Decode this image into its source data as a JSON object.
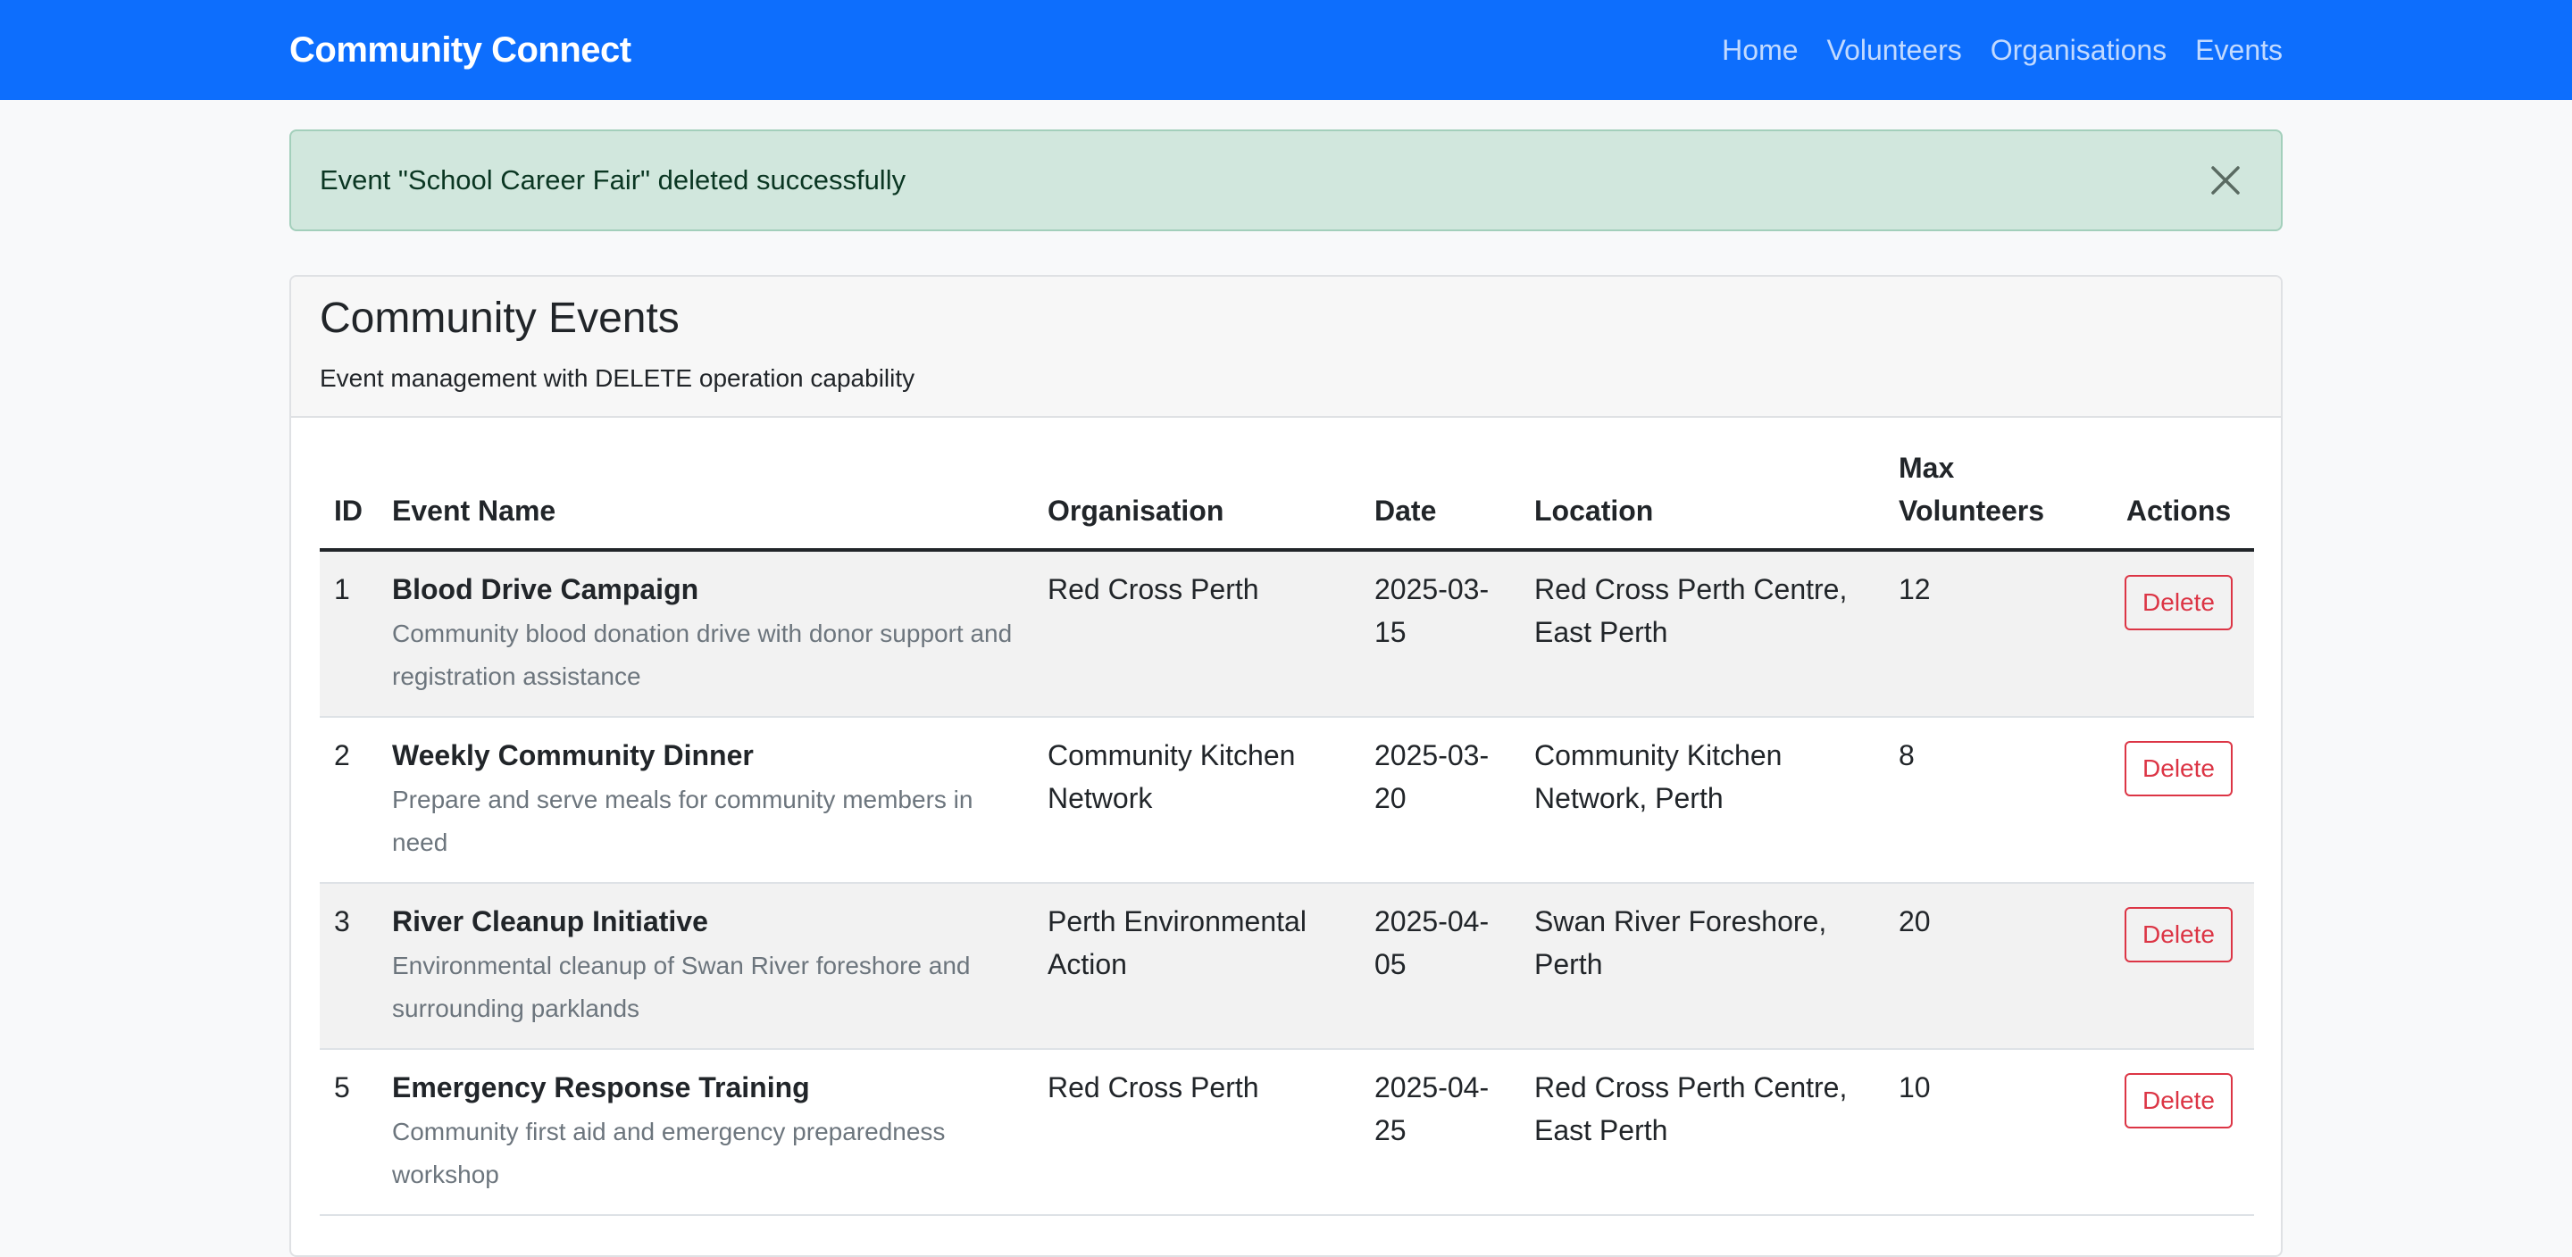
{
  "navbar": {
    "brand": "Community Connect",
    "links": [
      "Home",
      "Volunteers",
      "Organisations",
      "Events"
    ]
  },
  "alert": {
    "message": "Event \"School Career Fair\" deleted successfully",
    "close_icon": "close-icon"
  },
  "card": {
    "title": "Community Events",
    "subtitle": "Event management with DELETE operation capability"
  },
  "table": {
    "headers": {
      "id": "ID",
      "name": "Event Name",
      "org": "Organisation",
      "date": "Date",
      "location": "Location",
      "max_line1": "Max",
      "max_line2": "Volunteers",
      "actions": "Actions"
    },
    "rows": [
      {
        "id": "1",
        "name": "Blood Drive Campaign",
        "description": "Community blood donation drive with donor support and registration assistance",
        "org": "Red Cross Perth",
        "date_line1": "2025-03-",
        "date_line2": "15",
        "location": "Red Cross Perth Centre, East Perth",
        "max": "12",
        "action": "Delete"
      },
      {
        "id": "2",
        "name": "Weekly Community Dinner",
        "description": "Prepare and serve meals for community members in need",
        "org": "Community Kitchen Network",
        "date_line1": "2025-03-",
        "date_line2": "20",
        "location": "Community Kitchen Network, Perth",
        "max": "8",
        "action": "Delete"
      },
      {
        "id": "3",
        "name": "River Cleanup Initiative",
        "description": "Environmental cleanup of Swan River foreshore and surrounding parklands",
        "org": "Perth Environmental Action",
        "date_line1": "2025-04-",
        "date_line2": "05",
        "location": "Swan River Foreshore, Perth",
        "max": "20",
        "action": "Delete"
      },
      {
        "id": "5",
        "name": "Emergency Response Training",
        "description": "Community first aid and emergency preparedness workshop",
        "org": "Red Cross Perth",
        "date_line1": "2025-04-",
        "date_line2": "25",
        "location": "Red Cross Perth Centre, East Perth",
        "max": "10",
        "action": "Delete"
      }
    ]
  },
  "colors": {
    "primary": "#0d6efd",
    "success_bg": "#d1e7dd",
    "danger": "#dc3545"
  }
}
